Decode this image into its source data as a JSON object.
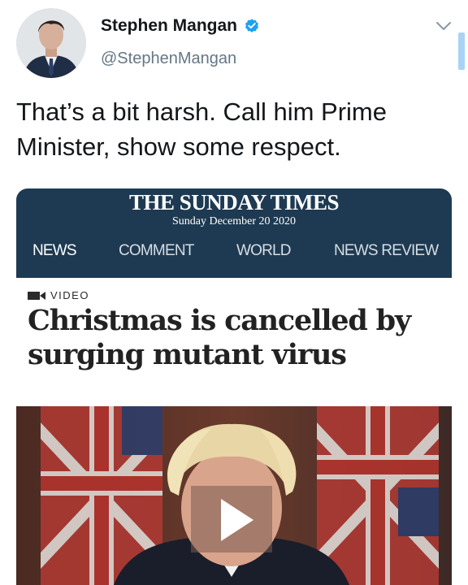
{
  "tweet": {
    "display_name": "Stephen Mangan",
    "handle": "@StephenMangan",
    "text": "That’s a bit harsh. Call him Prime Minister, show some respect.",
    "verified_color": "#1da1f2"
  },
  "card": {
    "publication": "THE SUNDAY TIMES",
    "date": "Sunday December 20 2020",
    "nav": [
      "NEWS",
      "COMMENT",
      "WORLD",
      "NEWS REVIEW"
    ],
    "tag": "VIDEO",
    "headline": "Christmas is cancelled by surging mutant virus",
    "masthead_color": "#1e3a52"
  },
  "icons": [
    "verified-badge-icon",
    "chevron-down-icon",
    "video-camera-icon",
    "play-icon"
  ]
}
